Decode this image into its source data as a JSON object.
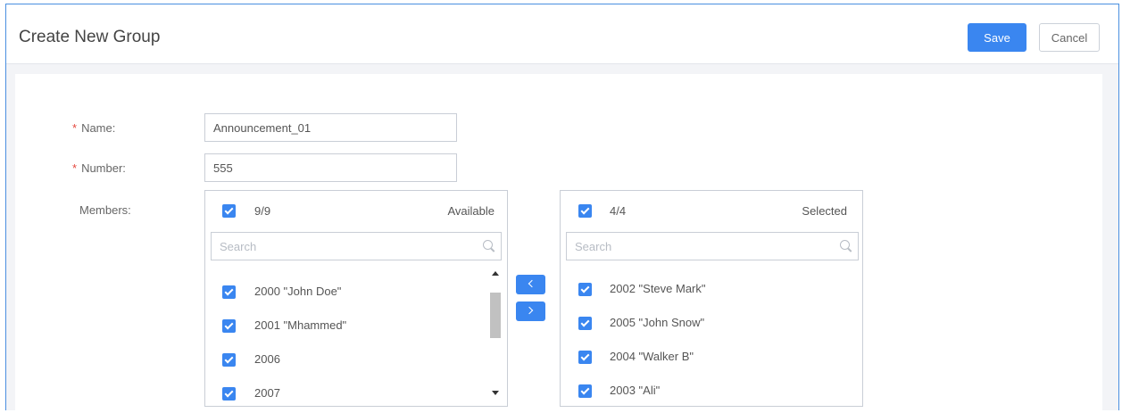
{
  "header": {
    "title": "Create New Group",
    "save_label": "Save",
    "cancel_label": "Cancel"
  },
  "form": {
    "name_label": "Name:",
    "name_value": "Announcement_01",
    "number_label": "Number:",
    "number_value": "555",
    "members_label": "Members:",
    "required_marker": "*"
  },
  "available": {
    "count": "9/9",
    "title": "Available",
    "search_placeholder": "Search",
    "items": [
      "2000 \"John Doe\"",
      "2001 \"Mhammed\"",
      "2006",
      "2007"
    ]
  },
  "selected": {
    "count": "4/4",
    "title": "Selected",
    "search_placeholder": "Search",
    "items": [
      "2002 \"Steve Mark\"",
      "2005 \"John Snow\"",
      "2004 \"Walker B\"",
      "2003 \"Ali\""
    ]
  },
  "colors": {
    "accent": "#3a86f0",
    "required": "#e5483f",
    "frame_border": "#4a8fe0"
  },
  "icons": {
    "checkbox": "checkbox-checked-icon",
    "search": "search-icon",
    "move_left": "chevron-left-icon",
    "move_right": "chevron-right-icon"
  }
}
